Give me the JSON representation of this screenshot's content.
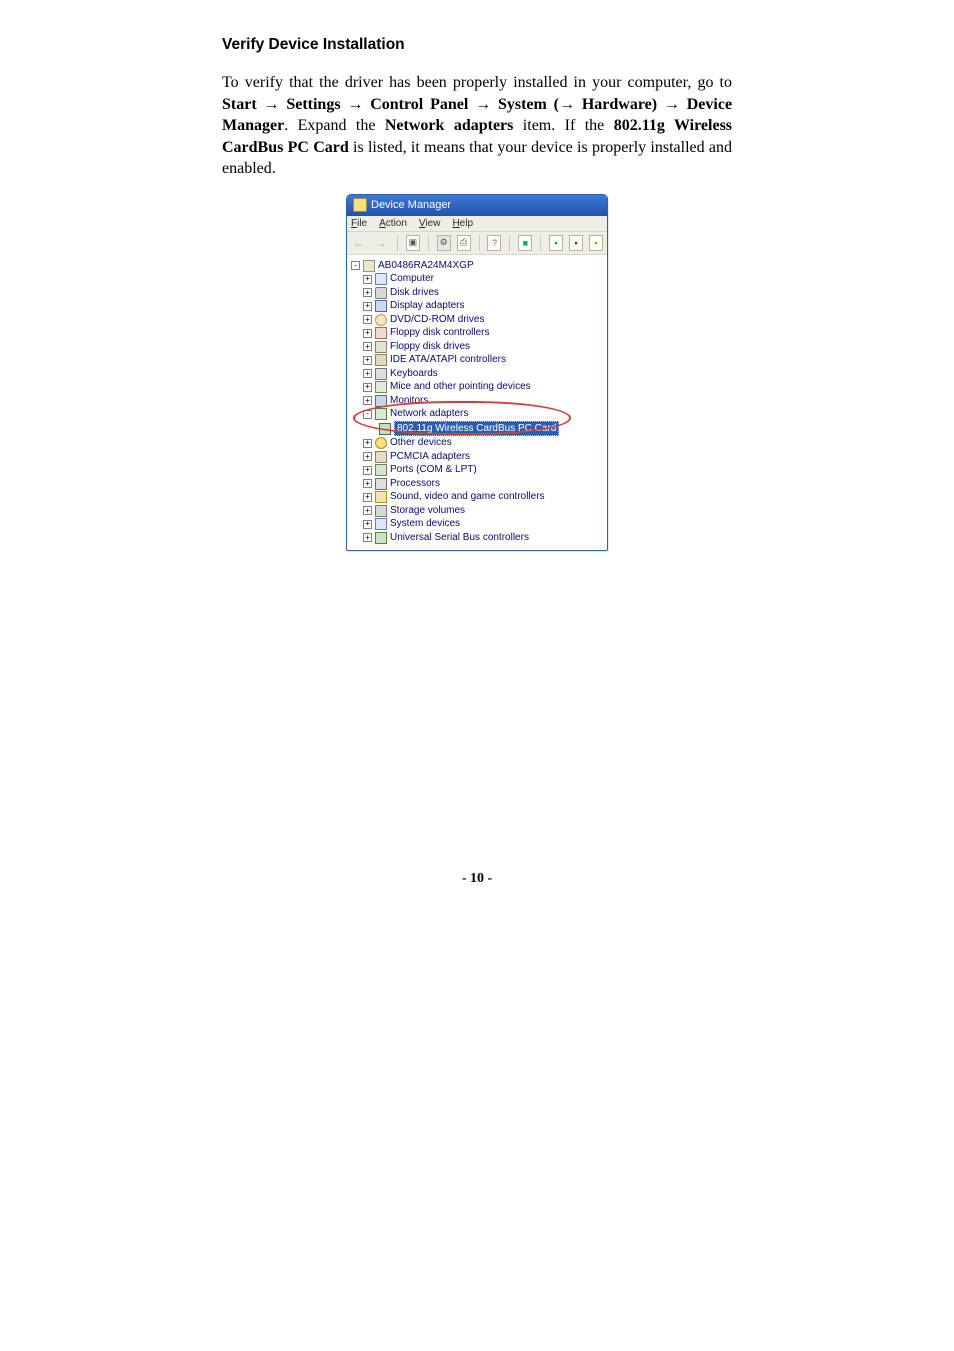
{
  "doc": {
    "heading": "Verify Device Installation",
    "para": {
      "lead": "To verify that the driver has been properly installed in your computer, go to ",
      "start": "Start",
      "arrow": "→",
      "settings": "Settings",
      "cpanel": "Control Panel",
      "system": "System",
      "hw_open": "(",
      "hardware": "Hardware)",
      "dm": "Device Manager",
      "mid1": ". Expand the ",
      "netadapt": "Network adapters",
      "mid2": " item. If the ",
      "device": "802.11g Wireless CardBus PC Card",
      "tail": " is listed, it means that your device is properly installed and enabled."
    },
    "pagenum": "- 10 -"
  },
  "dm": {
    "title": "Device Manager",
    "menu": {
      "file": "File",
      "action": "Action",
      "view": "View",
      "help": "Help"
    },
    "toolbar": {
      "back": "←",
      "fwd": "→",
      "box": "▣",
      "gear": "⚙",
      "print": "⎙",
      "help": "?",
      "hw": "■",
      "n1": "▪",
      "n2": "▪",
      "n3": "▪"
    },
    "tree": {
      "root": "AB0486RA24M4XGP",
      "computer": "Computer",
      "disk": "Disk drives",
      "display": "Display adapters",
      "dvd": "DVD/CD-ROM drives",
      "fdc": "Floppy disk controllers",
      "fdd": "Floppy disk drives",
      "ide": "IDE ATA/ATAPI controllers",
      "kbd": "Keyboards",
      "mice": "Mice and other pointing devices",
      "mon": "Monitors",
      "net": "Network adapters",
      "card": "802.11g Wireless CardBus PC Card",
      "other": "Other devices",
      "pcmcia": "PCMCIA adapters",
      "ports": "Ports (COM & LPT)",
      "cpu": "Processors",
      "snd": "Sound, video and game controllers",
      "stor": "Storage volumes",
      "sys": "System devices",
      "usb": "Universal Serial Bus controllers"
    }
  }
}
